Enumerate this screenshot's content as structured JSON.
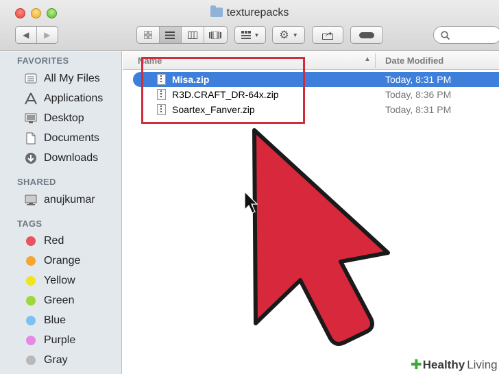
{
  "window": {
    "title": "texturepacks",
    "toolbar": {
      "back_icon": "chevron-left-icon",
      "forward_icon": "chevron-right-icon",
      "view_icons": [
        "icon-view-icon",
        "list-view-icon",
        "column-view-icon",
        "coverflow-view-icon"
      ],
      "arrange_icon": "arrange-grid-icon",
      "action_icon": "gear-icon",
      "share_icon": "share-icon",
      "tag_icon": "tag-icon",
      "search_icon": "search-icon"
    }
  },
  "sidebar": {
    "favorites_header": "FAVORITES",
    "favorites": [
      {
        "label": "All My Files",
        "icon": "all-files-icon"
      },
      {
        "label": "Applications",
        "icon": "applications-icon"
      },
      {
        "label": "Desktop",
        "icon": "desktop-icon"
      },
      {
        "label": "Documents",
        "icon": "documents-icon"
      },
      {
        "label": "Downloads",
        "icon": "downloads-icon"
      }
    ],
    "shared_header": "SHARED",
    "shared": [
      {
        "label": "anujkumar",
        "icon": "computer-icon"
      }
    ],
    "tags_header": "TAGS",
    "tags": [
      {
        "label": "Red",
        "color": "#e9545f"
      },
      {
        "label": "Orange",
        "color": "#f6a531"
      },
      {
        "label": "Yellow",
        "color": "#f0e41e"
      },
      {
        "label": "Green",
        "color": "#9fd63b"
      },
      {
        "label": "Blue",
        "color": "#7cc1f2"
      },
      {
        "label": "Purple",
        "color": "#e48ae6"
      },
      {
        "label": "Gray",
        "color": "#b9b9b9"
      }
    ]
  },
  "filelist": {
    "columns": {
      "name": "Name",
      "date": "Date Modified"
    },
    "files": [
      {
        "name": "Misa.zip",
        "date": "Today, 8:31 PM",
        "selected": true
      },
      {
        "name": "R3D.CRAFT_DR-64x.zip",
        "date": "Today, 8:36 PM",
        "selected": false
      },
      {
        "name": "Soartex_Fanver.zip",
        "date": "Today, 8:31 PM",
        "selected": false
      }
    ]
  },
  "annotation": {
    "highlight_color": "#d22b3c",
    "arrow_color": "#d8283b"
  },
  "watermark": {
    "brand_part1": "Healthy",
    "brand_part2": "Living",
    "brand_color": "#3aaa35"
  }
}
